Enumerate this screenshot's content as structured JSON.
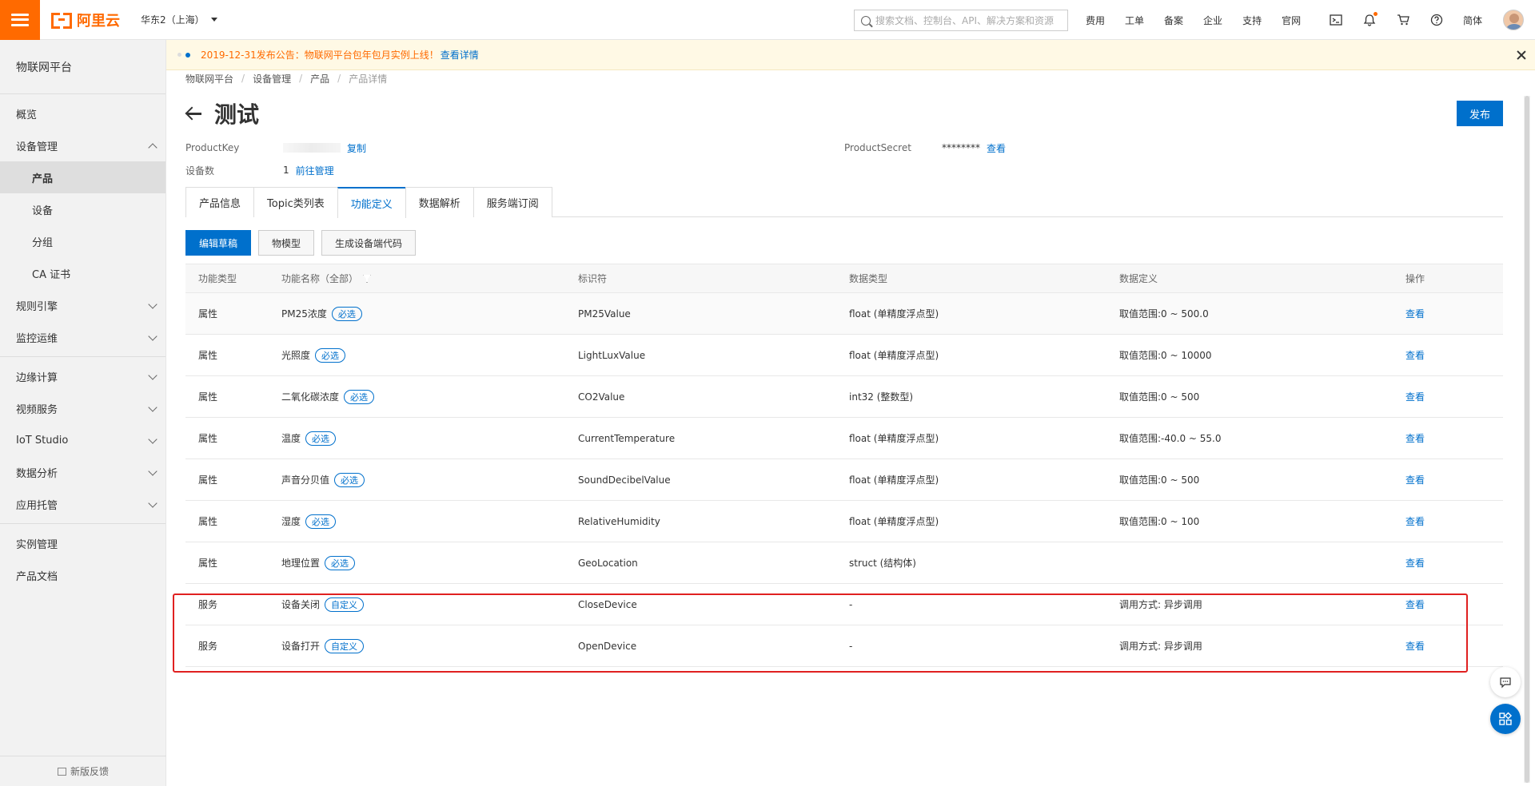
{
  "header": {
    "logo_text": "阿里云",
    "region": "华东2（上海）",
    "search_placeholder": "搜索文档、控制台、API、解决方案和资源",
    "links": [
      "费用",
      "工单",
      "备案",
      "企业",
      "支持",
      "官网"
    ],
    "lang": "简体",
    "accent_color": "#ff6a00"
  },
  "sidebar": {
    "title": "物联网平台",
    "items": [
      {
        "label": "概览"
      },
      {
        "label": "设备管理"
      },
      {
        "label": "产品"
      },
      {
        "label": "设备"
      },
      {
        "label": "分组"
      },
      {
        "label": "CA 证书"
      },
      {
        "label": "规则引擎"
      },
      {
        "label": "监控运维"
      },
      {
        "label": "边缘计算"
      },
      {
        "label": "视频服务"
      },
      {
        "label": "IoT Studio"
      },
      {
        "label": "数据分析"
      },
      {
        "label": "应用托管"
      },
      {
        "label": "实例管理"
      },
      {
        "label": "产品文档"
      }
    ],
    "feedback": "新版反馈"
  },
  "notice": {
    "text": "2019-12-31发布公告：物联网平台包年包月实例上线！",
    "link": "查看详情"
  },
  "breadcrumb": [
    "物联网平台",
    "设备管理",
    "产品",
    "产品详情"
  ],
  "page": {
    "title": "测试",
    "publish_label": "发布",
    "product_key_label": "ProductKey",
    "copy_label": "复制",
    "product_secret_label": "ProductSecret",
    "product_secret_value": "********",
    "view_label": "查看",
    "device_count_label": "设备数",
    "device_count_value": "1",
    "manage_label": "前往管理"
  },
  "tabs": [
    "产品信息",
    "Topic类列表",
    "功能定义",
    "数据解析",
    "服务端订阅"
  ],
  "actions": [
    "编辑草稿",
    "物模型",
    "生成设备端代码"
  ],
  "table": {
    "headers": [
      "功能类型",
      "功能名称（全部）",
      "标识符",
      "数据类型",
      "数据定义",
      "操作"
    ],
    "rows": [
      {
        "type": "属性",
        "name": "PM25浓度",
        "tag": "必选",
        "id": "PM25Value",
        "dtype": "float (单精度浮点型)",
        "def": "取值范围:0 ~ 500.0",
        "op": "查看"
      },
      {
        "type": "属性",
        "name": "光照度",
        "tag": "必选",
        "id": "LightLuxValue",
        "dtype": "float (单精度浮点型)",
        "def": "取值范围:0 ~ 10000",
        "op": "查看"
      },
      {
        "type": "属性",
        "name": "二氧化碳浓度",
        "tag": "必选",
        "id": "CO2Value",
        "dtype": "int32 (整数型)",
        "def": "取值范围:0 ~ 500",
        "op": "查看"
      },
      {
        "type": "属性",
        "name": "温度",
        "tag": "必选",
        "id": "CurrentTemperature",
        "dtype": "float (单精度浮点型)",
        "def": "取值范围:-40.0 ~ 55.0",
        "op": "查看"
      },
      {
        "type": "属性",
        "name": "声音分贝值",
        "tag": "必选",
        "id": "SoundDecibelValue",
        "dtype": "float (单精度浮点型)",
        "def": "取值范围:0 ~ 500",
        "op": "查看"
      },
      {
        "type": "属性",
        "name": "湿度",
        "tag": "必选",
        "id": "RelativeHumidity",
        "dtype": "float (单精度浮点型)",
        "def": "取值范围:0 ~ 100",
        "op": "查看"
      },
      {
        "type": "属性",
        "name": "地理位置",
        "tag": "必选",
        "id": "GeoLocation",
        "dtype": "struct (结构体)",
        "def": "",
        "op": "查看"
      },
      {
        "type": "服务",
        "name": "设备关闭",
        "tag": "自定义",
        "id": "CloseDevice",
        "dtype": "-",
        "def": "调用方式: 异步调用",
        "op": "查看"
      },
      {
        "type": "服务",
        "name": "设备打开",
        "tag": "自定义",
        "id": "OpenDevice",
        "dtype": "-",
        "def": "调用方式: 异步调用",
        "op": "查看"
      }
    ]
  },
  "colors": {
    "primary": "#0070cc",
    "highlight": "#e02020"
  }
}
